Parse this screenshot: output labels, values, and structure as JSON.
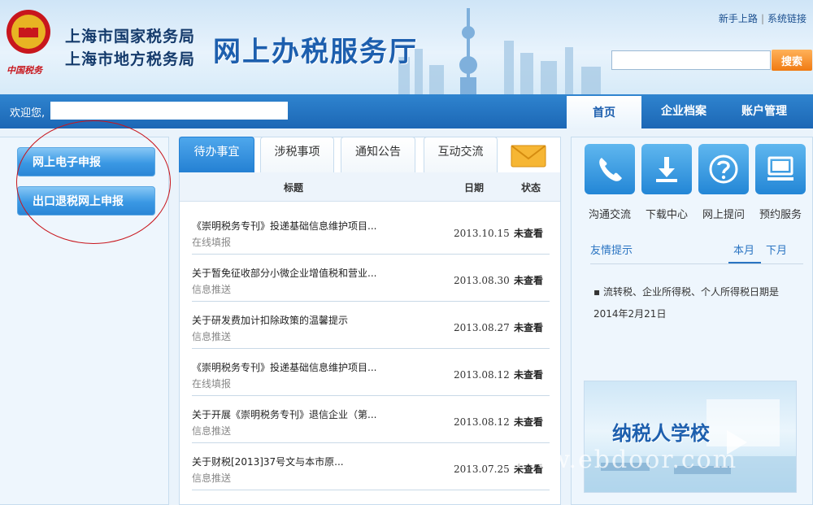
{
  "header": {
    "bureau_line1": "上海市国家税务局",
    "bureau_line2": "上海市地方税务局",
    "hall_title": "网上办税服务厅",
    "emblem_text": "中国税务",
    "links": [
      "新手上路",
      "系统链接"
    ],
    "search": {
      "value": "",
      "button_label": "搜索"
    }
  },
  "navbar": {
    "welcome": "欢迎您,",
    "tabs": [
      {
        "label": "首页",
        "active": true
      },
      {
        "label": "企业档案",
        "active": false
      },
      {
        "label": "账户管理",
        "active": false
      }
    ]
  },
  "sidebar": {
    "buttons": [
      "网上电子申报",
      "出口退税网上申报"
    ]
  },
  "main": {
    "tabs": [
      {
        "label": "待办事宜",
        "active": true
      },
      {
        "label": "涉税事项",
        "active": false
      },
      {
        "label": "通知公告",
        "active": false
      },
      {
        "label": "互动交流",
        "active": false
      }
    ],
    "columns": {
      "title": "标题",
      "date": "日期",
      "status": "状态"
    },
    "rows": [
      {
        "title": "《崇明税务专刊》投递基础信息维护项目...",
        "sub": "在线填报",
        "date": "2013.10.15",
        "status": "未查看"
      },
      {
        "title": "关于暂免征收部分小微企业增值税和营业...",
        "sub": "信息推送",
        "date": "2013.08.30",
        "status": "未查看"
      },
      {
        "title": "关于研发费加计扣除政策的温馨提示",
        "sub": "信息推送",
        "date": "2013.08.27",
        "status": "未查看"
      },
      {
        "title": "《崇明税务专刊》投递基础信息维护项目...",
        "sub": "在线填报",
        "date": "2013.08.12",
        "status": "未查看"
      },
      {
        "title": "关于开展《崇明税务专刊》退信企业（第...",
        "sub": "信息推送",
        "date": "2013.08.12",
        "status": "未查看"
      },
      {
        "title": "关于财税[2013]37号文与本市原...",
        "sub": "信息推送",
        "date": "2013.07.25",
        "status": "未查看"
      }
    ]
  },
  "right": {
    "tiles": [
      "沟通交流",
      "下载中心",
      "网上提问",
      "预约服务"
    ],
    "tips": {
      "title": "友情提示",
      "tabs": [
        "本月",
        "下月"
      ],
      "items": [
        "流转税、企业所得税、个人所得税日期是2014年2月21日"
      ]
    },
    "school_banner": "纳税人学校"
  },
  "watermark": "www.ebdoor.com",
  "colors": {
    "brand_blue": "#1d5fae",
    "nav_blue": "#2470c0",
    "accent_orange": "#f07a12",
    "annotation_red": "#c8161d"
  }
}
